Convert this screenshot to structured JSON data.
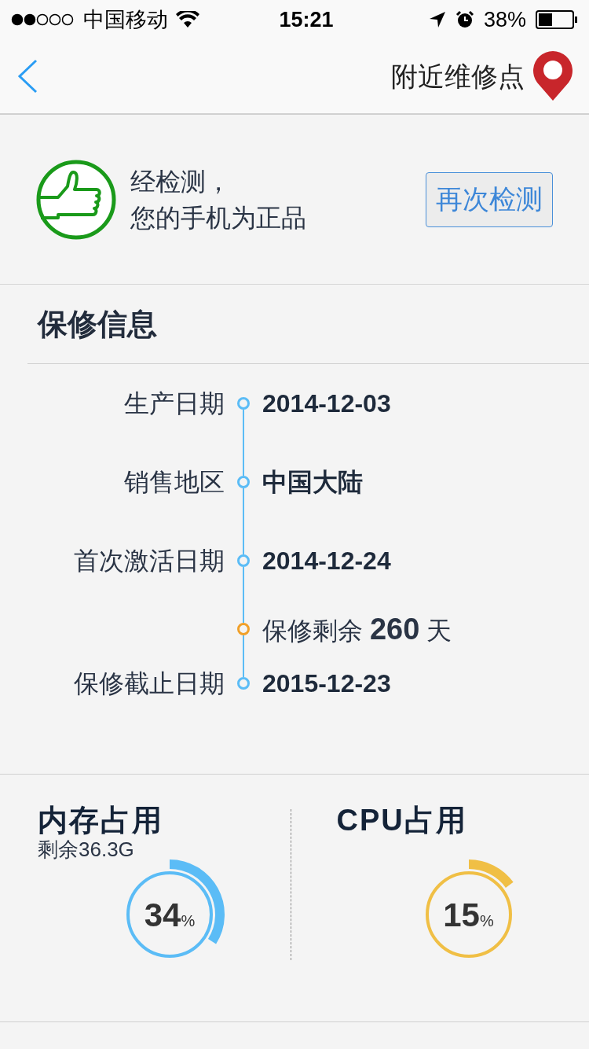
{
  "status_bar": {
    "carrier": "中国移动",
    "time": "15:21",
    "battery": "38%"
  },
  "nav": {
    "action": "附近维修点"
  },
  "check": {
    "message_line1": "经检测，",
    "message_line2": "您的手机为正品",
    "button": "再次检测"
  },
  "warranty": {
    "title": "保修信息",
    "rows": [
      {
        "kind": "date",
        "label": "生产日期",
        "value": "2014-12-03"
      },
      {
        "kind": "date",
        "label": "销售地区",
        "value": "中国大陆"
      },
      {
        "kind": "date",
        "label": "首次激活日期",
        "value": "2014-12-24"
      },
      {
        "kind": "remaining",
        "value": "保修剩余 **260** 天"
      },
      {
        "kind": "date",
        "label": "保修截止日期",
        "value": "2015-12-23"
      }
    ]
  },
  "usage": [
    {
      "title": "内存占用",
      "subtitle": "剩余36.3G",
      "value": "34",
      "unit": "%",
      "color": "#5bbcf6"
    },
    {
      "title": "CPU占用",
      "value": "15",
      "unit": "%",
      "color": "#f0bf45"
    }
  ]
}
